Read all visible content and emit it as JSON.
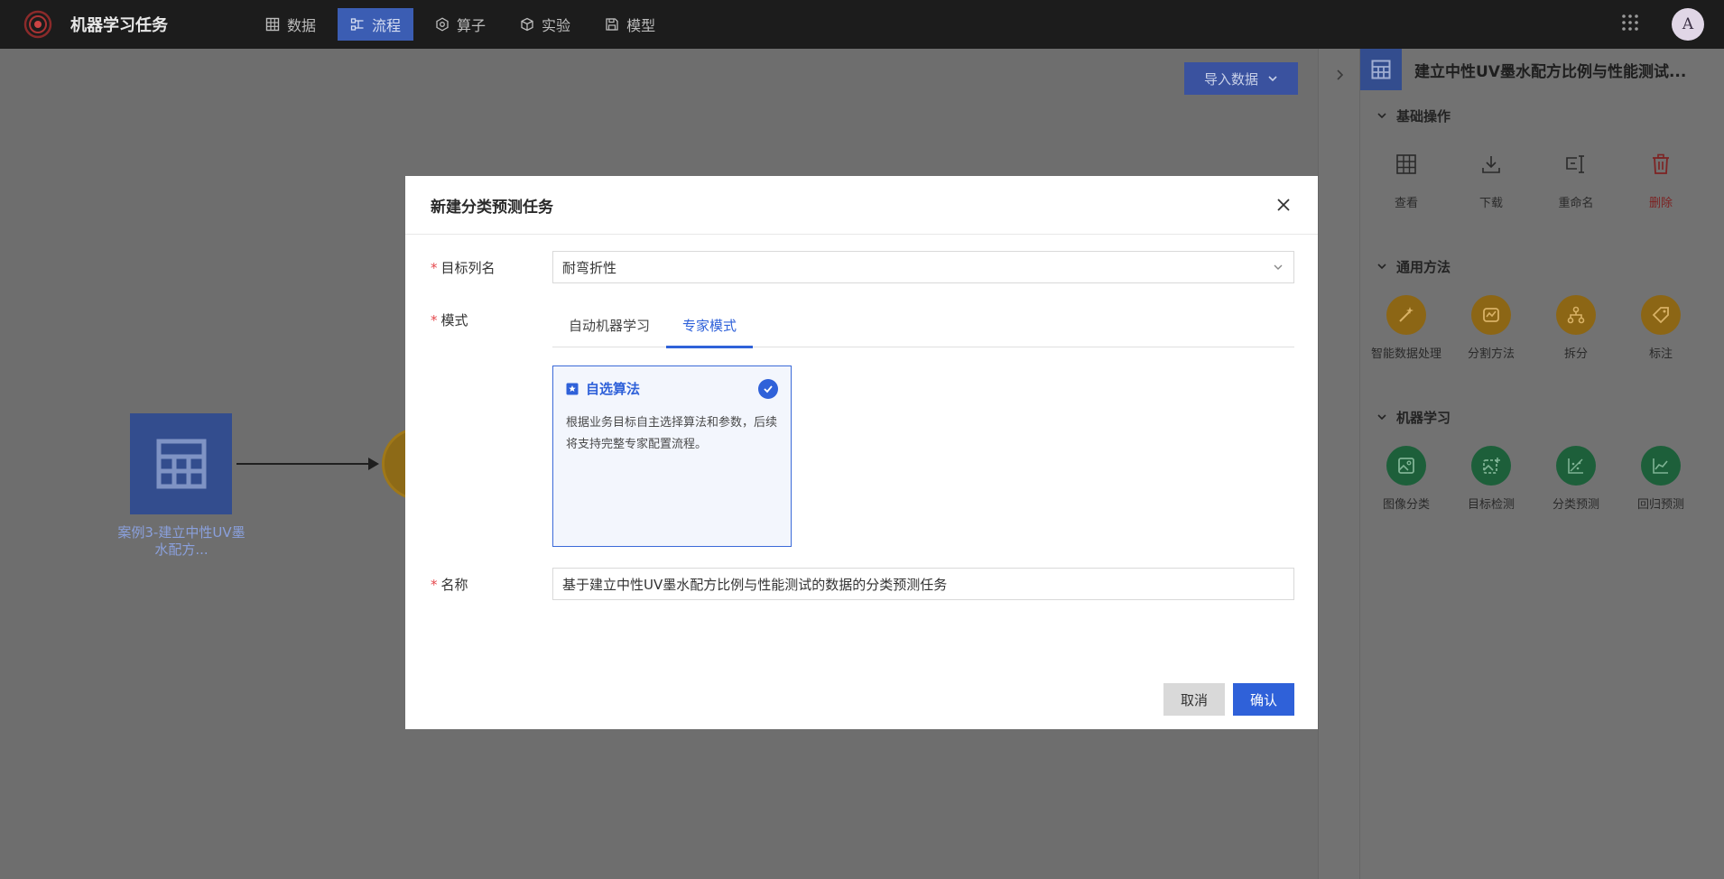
{
  "app": {
    "title": "机器学习任务",
    "avatar_letter": "A"
  },
  "nav": {
    "items": [
      {
        "label": "数据",
        "icon": "table-icon",
        "active": false
      },
      {
        "label": "流程",
        "icon": "flow-icon",
        "active": true
      },
      {
        "label": "算子",
        "icon": "hexagon-gear-icon",
        "active": false
      },
      {
        "label": "实验",
        "icon": "cube-icon",
        "active": false
      },
      {
        "label": "模型",
        "icon": "save-icon",
        "active": false
      }
    ]
  },
  "canvas": {
    "import_button": "导入数据",
    "node_label": "案例3-建立中性UV墨水配方..."
  },
  "right_panel": {
    "title": "建立中性UV墨水配方比例与性能测试...",
    "sections": [
      {
        "title": "基础操作",
        "actions": [
          {
            "label": "查看",
            "icon": "table-icon"
          },
          {
            "label": "下载",
            "icon": "download-icon"
          },
          {
            "label": "重命名",
            "icon": "rename-icon"
          },
          {
            "label": "删除",
            "icon": "trash-icon"
          }
        ]
      },
      {
        "title": "通用方法",
        "actions": [
          {
            "label": "智能数据处理",
            "icon": "magic-wand-icon"
          },
          {
            "label": "分割方法",
            "icon": "map-icon"
          },
          {
            "label": "拆分",
            "icon": "split-icon"
          },
          {
            "label": "标注",
            "icon": "tag-icon"
          }
        ]
      },
      {
        "title": "机器学习",
        "actions": [
          {
            "label": "图像分类",
            "icon": "image-icon"
          },
          {
            "label": "目标检测",
            "icon": "image-plus-icon"
          },
          {
            "label": "分类预测",
            "icon": "scatter-icon"
          },
          {
            "label": "回归预测",
            "icon": "line-chart-icon"
          }
        ]
      }
    ]
  },
  "modal": {
    "title": "新建分类预测任务",
    "target_label": "目标列名",
    "target_value": "耐弯折性",
    "mode_label": "模式",
    "tabs": [
      {
        "label": "自动机器学习",
        "active": false
      },
      {
        "label": "专家模式",
        "active": true
      }
    ],
    "card": {
      "title": "自选算法",
      "description": "根据业务目标自主选择算法和参数，后续将支持完整专家配置流程。"
    },
    "name_label": "名称",
    "name_value": "基于建立中性UV墨水配方比例与性能测试的数据的分类预测任务",
    "cancel": "取消",
    "confirm": "确认"
  },
  "colors": {
    "accent": "#2f61d9",
    "danger": "#e5484d",
    "topbar": "#1c1c1c"
  }
}
